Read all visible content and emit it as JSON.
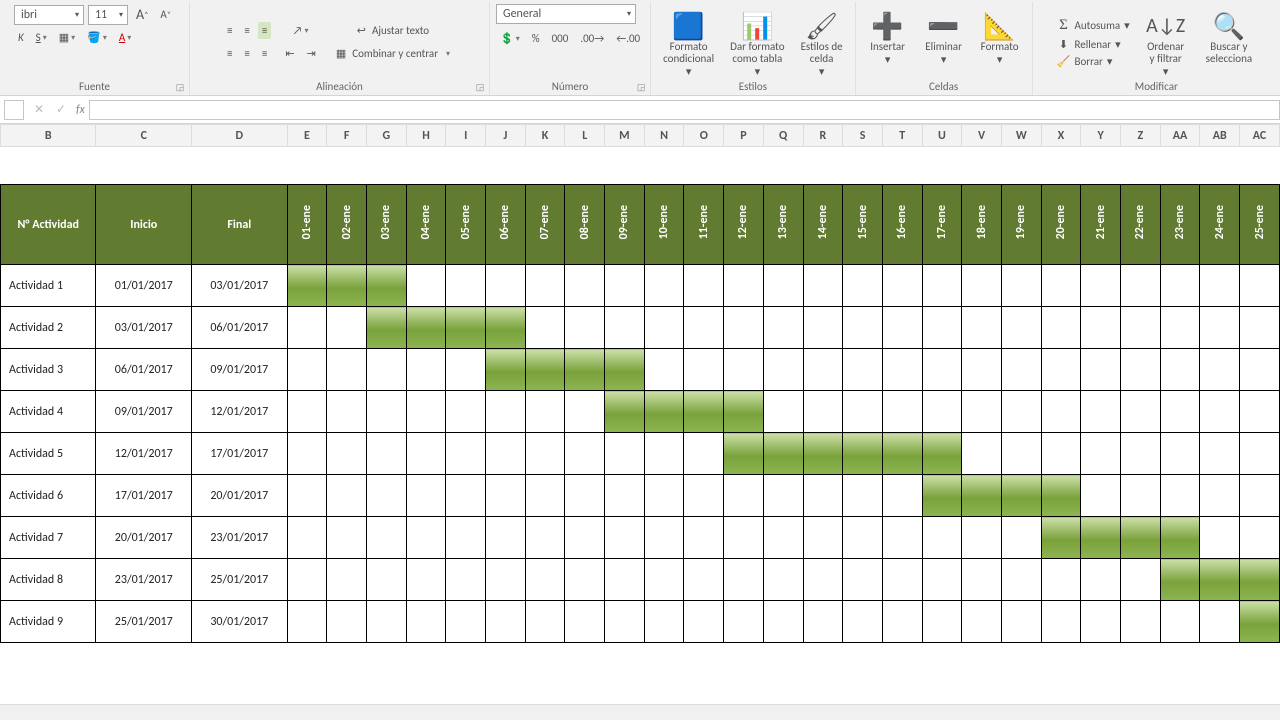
{
  "ribbon": {
    "font": {
      "name": "ibri",
      "size": "11",
      "label": "Fuente"
    },
    "alignment": {
      "wrap": "Ajustar texto",
      "merge": "Combinar y centrar",
      "label": "Alineación"
    },
    "number": {
      "format": "General",
      "label": "Número"
    },
    "styles": {
      "cond": "Formato\ncondicional",
      "table": "Dar formato\ncomo tabla",
      "cell": "Estilos de\ncelda",
      "label": "Estilos"
    },
    "cells": {
      "insert": "Insertar",
      "delete": "Eliminar",
      "format": "Formato",
      "label": "Celdas"
    },
    "editing": {
      "sum": "Autosuma",
      "fill": "Rellenar",
      "clear": "Borrar",
      "sort": "Ordenar\ny filtrar",
      "find": "Buscar y\nselecciona",
      "label": "Modificar"
    }
  },
  "formula_bar": {
    "value": ""
  },
  "columns": [
    "B",
    "C",
    "D",
    "E",
    "F",
    "G",
    "H",
    "I",
    "J",
    "K",
    "L",
    "M",
    "N",
    "O",
    "P",
    "Q",
    "R",
    "S",
    "T",
    "U",
    "V",
    "W",
    "X",
    "Y",
    "Z",
    "AA",
    "AB",
    "AC"
  ],
  "headers": {
    "activity": "N° Actividad",
    "start": "Inicio",
    "end": "Final"
  },
  "dates": [
    "01-ene",
    "02-ene",
    "03-ene",
    "04-ene",
    "05-ene",
    "06-ene",
    "07-ene",
    "08-ene",
    "09-ene",
    "10-ene",
    "11-ene",
    "12-ene",
    "13-ene",
    "14-ene",
    "15-ene",
    "16-ene",
    "17-ene",
    "18-ene",
    "19-ene",
    "20-ene",
    "21-ene",
    "22-ene",
    "23-ene",
    "24-ene",
    "25-ene"
  ],
  "activities": [
    {
      "name": "Actividad 1",
      "start": "01/01/2017",
      "end": "03/01/2017",
      "from": 1,
      "to": 3
    },
    {
      "name": "Actividad 2",
      "start": "03/01/2017",
      "end": "06/01/2017",
      "from": 3,
      "to": 6
    },
    {
      "name": "Actividad 3",
      "start": "06/01/2017",
      "end": "09/01/2017",
      "from": 6,
      "to": 9
    },
    {
      "name": "Actividad 4",
      "start": "09/01/2017",
      "end": "12/01/2017",
      "from": 9,
      "to": 12
    },
    {
      "name": "Actividad 5",
      "start": "12/01/2017",
      "end": "17/01/2017",
      "from": 12,
      "to": 17
    },
    {
      "name": "Actividad 6",
      "start": "17/01/2017",
      "end": "20/01/2017",
      "from": 17,
      "to": 20
    },
    {
      "name": "Actividad 7",
      "start": "20/01/2017",
      "end": "23/01/2017",
      "from": 20,
      "to": 23
    },
    {
      "name": "Actividad 8",
      "start": "23/01/2017",
      "end": "25/01/2017",
      "from": 23,
      "to": 25
    },
    {
      "name": "Actividad 9",
      "start": "25/01/2017",
      "end": "30/01/2017",
      "from": 25,
      "to": 30
    }
  ],
  "chart_data": {
    "type": "bar",
    "title": "",
    "xlabel": "",
    "ylabel": "",
    "categories": [
      "Actividad 1",
      "Actividad 2",
      "Actividad 3",
      "Actividad 4",
      "Actividad 5",
      "Actividad 6",
      "Actividad 7",
      "Actividad 8",
      "Actividad 9"
    ],
    "series": [
      {
        "name": "Inicio (día de enero 2017)",
        "values": [
          1,
          3,
          6,
          9,
          12,
          17,
          20,
          23,
          25
        ]
      },
      {
        "name": "Final (día de enero 2017)",
        "values": [
          3,
          6,
          9,
          12,
          17,
          20,
          23,
          25,
          30
        ]
      }
    ],
    "x": [
      "01-ene",
      "02-ene",
      "03-ene",
      "04-ene",
      "05-ene",
      "06-ene",
      "07-ene",
      "08-ene",
      "09-ene",
      "10-ene",
      "11-ene",
      "12-ene",
      "13-ene",
      "14-ene",
      "15-ene",
      "16-ene",
      "17-ene",
      "18-ene",
      "19-ene",
      "20-ene",
      "21-ene",
      "22-ene",
      "23-ene",
      "24-ene",
      "25-ene"
    ]
  }
}
